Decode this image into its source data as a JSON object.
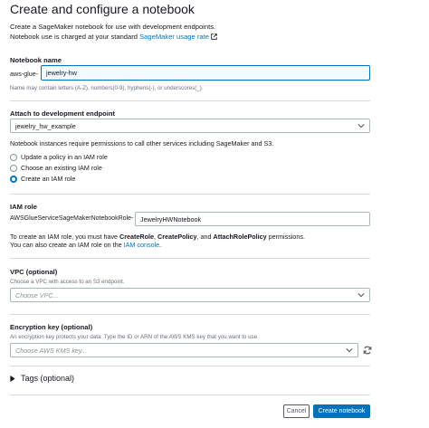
{
  "header": {
    "title": "Create and configure a notebook"
  },
  "intro": {
    "line1": "Create a SageMaker notebook for use with development endpoints.",
    "line2_prefix": "Notebook use is charged at your standard ",
    "pricing_link": "SageMaker usage rate"
  },
  "notebook_name": {
    "label": "Notebook name",
    "prefix": "aws-glue-",
    "value": "jewelry-hw",
    "hint": "Name may contain letters (A-Z), numbers(0-9), hyphens(-), or underscores(_)."
  },
  "endpoint": {
    "label": "Attach to development endpoint",
    "value": "jewelry_hw_example"
  },
  "permissions_text": "Notebook instances require permissions to call other services including SageMaker and S3.",
  "role_options": [
    {
      "label": "Update a policy in an IAM role",
      "checked": false
    },
    {
      "label": "Choose an existing IAM role",
      "checked": false
    },
    {
      "label": "Create an IAM role",
      "checked": true
    }
  ],
  "iam_role": {
    "label": "IAM role",
    "prefix": "AWSGlueServiceSageMakerNotebookRole-",
    "value": "JewelryHWNotebook",
    "info_prefix": "To create an IAM role, you must have ",
    "perm1": "CreateRole",
    "sep1": ", ",
    "perm2": "CreatePolicy",
    "sep2": ", and ",
    "perm3": "AttachRolePolicy",
    "info_suffix": " permissions.",
    "info2_prefix": "You can also create an IAM role on the ",
    "console_link": "IAM console",
    "info2_suffix": "."
  },
  "vpc": {
    "label": "VPC (optional)",
    "hint": "Choose a VPC with access to an S3 endpoint.",
    "placeholder": "Choose VPC..."
  },
  "encryption": {
    "label": "Encryption key (optional)",
    "hint": "An encryption key protects your data. Type the ID or ARN of the AWS KMS key that you want to use.",
    "placeholder": "Choose AWS KMS key..."
  },
  "tags": {
    "label": "Tags (optional)"
  },
  "footer": {
    "cancel_label": "Cancel",
    "create_label": "Create notebook"
  },
  "colors": {
    "accent": "#0073bb",
    "text": "#16191f",
    "muted": "#687078",
    "border": "#aab7b8"
  },
  "icons": [
    "external-link-icon",
    "chevron-down-icon",
    "refresh-icon",
    "caret-right-icon"
  ]
}
